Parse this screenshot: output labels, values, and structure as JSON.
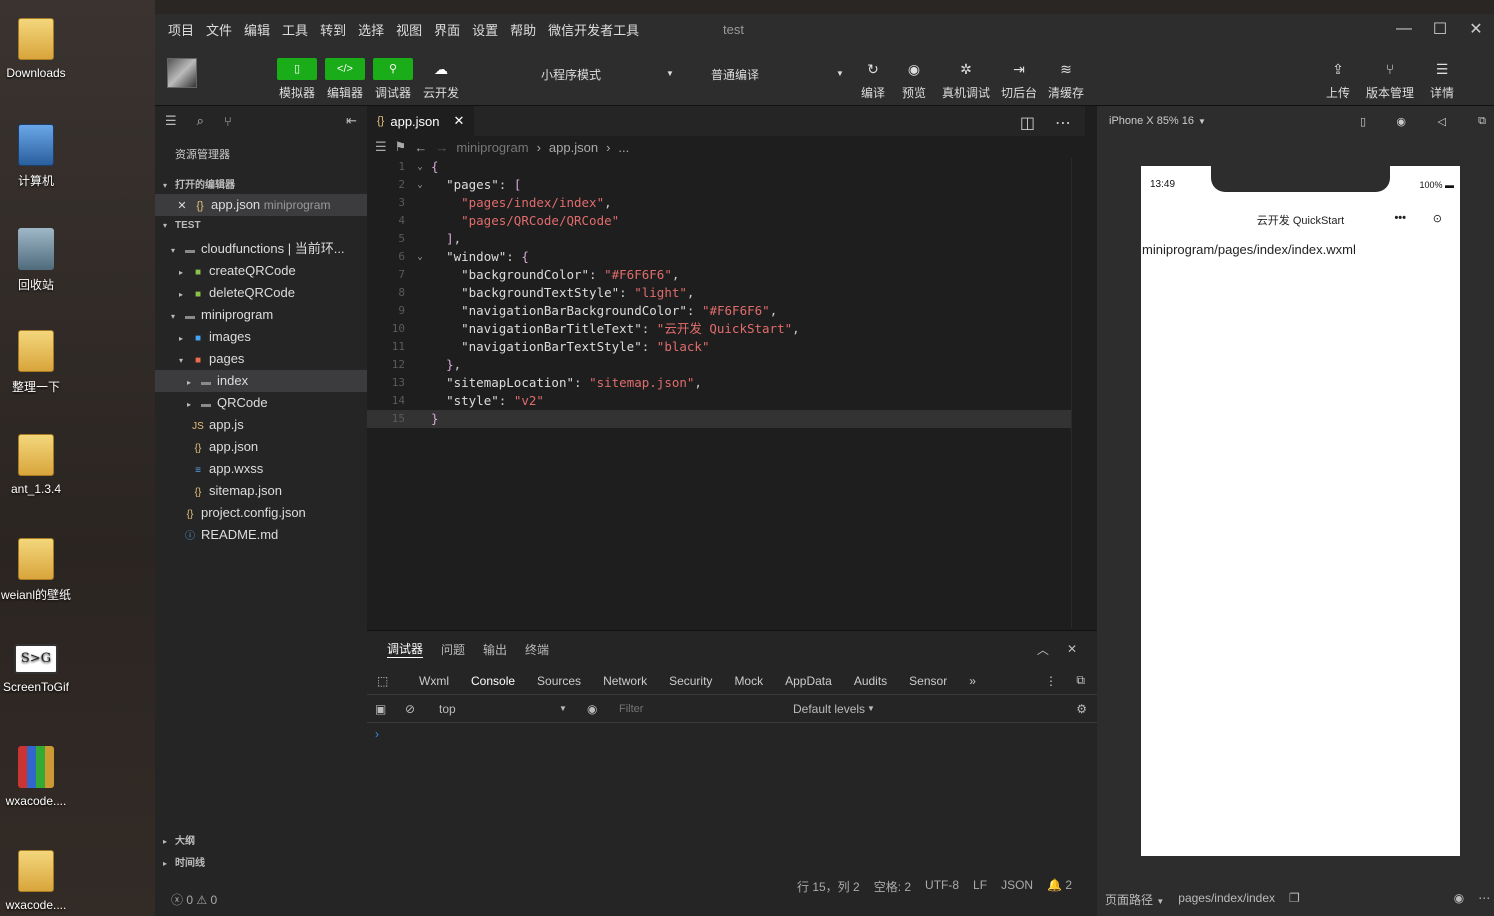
{
  "desktop": {
    "icons": [
      {
        "label": "Downloads",
        "kind": "folder-icon"
      },
      {
        "label": "计算机",
        "kind": "computer-icon"
      },
      {
        "label": "回收站",
        "kind": "recycle-bin-icon"
      },
      {
        "label": "整理一下",
        "kind": "folder-icon"
      },
      {
        "label": "ant_1.3.4",
        "kind": "folder-icon"
      },
      {
        "label": "weianl的壁纸",
        "kind": "folder-icon"
      },
      {
        "label": "ScreenToGif",
        "kind": "screentogif-icon"
      },
      {
        "label": "wxacode....",
        "kind": "winrar-icon"
      },
      {
        "label": "wxacode....",
        "kind": "folder-icon"
      }
    ]
  },
  "titlebar": {
    "menu": [
      "项目",
      "文件",
      "编辑",
      "工具",
      "转到",
      "选择",
      "视图",
      "界面",
      "设置",
      "帮助",
      "微信开发者工具"
    ],
    "title": "test"
  },
  "toolbar": {
    "simulator": "模拟器",
    "editor": "编辑器",
    "debugger": "调试器",
    "cloud": "云开发",
    "mode": "小程序模式",
    "compile_mode": "普通编译",
    "compile": "编译",
    "preview": "预览",
    "real_debug": "真机调试",
    "background": "切后台",
    "clear_cache": "清缓存",
    "upload": "上传",
    "version": "版本管理",
    "details": "详情"
  },
  "sidebar": {
    "title": "资源管理器",
    "open_editors": "打开的编辑器",
    "open_file": "app.json",
    "open_file_dir": "miniprogram",
    "project": "TEST",
    "tree": [
      {
        "label": "cloudfunctions | 当前环...",
        "depth": 1,
        "arrow": "▾",
        "icon": "folder"
      },
      {
        "label": "createQRCode",
        "depth": 2,
        "arrow": "▸",
        "icon": "cloud-folder"
      },
      {
        "label": "deleteQRCode",
        "depth": 2,
        "arrow": "▸",
        "icon": "cloud-folder"
      },
      {
        "label": "miniprogram",
        "depth": 1,
        "arrow": "▾",
        "icon": "folder"
      },
      {
        "label": "images",
        "depth": 2,
        "arrow": "▸",
        "icon": "images-folder"
      },
      {
        "label": "pages",
        "depth": 2,
        "arrow": "▾",
        "icon": "pages-folder"
      },
      {
        "label": "index",
        "depth": 3,
        "arrow": "▸",
        "icon": "folder",
        "selected": true
      },
      {
        "label": "QRCode",
        "depth": 3,
        "arrow": "▸",
        "icon": "folder"
      },
      {
        "label": "app.js",
        "depth": 2,
        "arrow": "",
        "icon": "js"
      },
      {
        "label": "app.json",
        "depth": 2,
        "arrow": "",
        "icon": "json"
      },
      {
        "label": "app.wxss",
        "depth": 2,
        "arrow": "",
        "icon": "wxss"
      },
      {
        "label": "sitemap.json",
        "depth": 2,
        "arrow": "",
        "icon": "json"
      },
      {
        "label": "project.config.json",
        "depth": 1,
        "arrow": "",
        "icon": "json"
      },
      {
        "label": "README.md",
        "depth": 1,
        "arrow": "",
        "icon": "info"
      }
    ],
    "outline": "大纲",
    "timeline": "时间线",
    "errors": "0",
    "warnings": "0"
  },
  "editor": {
    "tab": "app.json",
    "breadcrumb": [
      "miniprogram",
      "app.json",
      "..."
    ],
    "lines": [
      "{",
      "  \"pages\": [",
      "    \"pages/index/index\",",
      "    \"pages/QRCode/QRCode\"",
      "  ],",
      "  \"window\": {",
      "    \"backgroundColor\": \"#F6F6F6\",",
      "    \"backgroundTextStyle\": \"light\",",
      "    \"navigationBarBackgroundColor\": \"#F6F6F6\",",
      "    \"navigationBarTitleText\": \"云开发 QuickStart\",",
      "    \"navigationBarTextStyle\": \"black\"",
      "  },",
      "  \"sitemapLocation\": \"sitemap.json\",",
      "  \"style\": \"v2\"",
      "}"
    ]
  },
  "panel": {
    "tabs": [
      "调试器",
      "问题",
      "输出",
      "终端"
    ],
    "devtabs": [
      "Wxml",
      "Console",
      "Sources",
      "Network",
      "Security",
      "Mock",
      "AppData",
      "Audits",
      "Sensor"
    ],
    "context": "top",
    "filter_placeholder": "Filter",
    "levels": "Default levels"
  },
  "statusbar": {
    "position": "行 15，列 2",
    "spaces": "空格: 2",
    "encoding": "UTF-8",
    "eol": "LF",
    "lang": "JSON",
    "notifications": "2"
  },
  "simulator": {
    "device": "iPhone X 85% 16",
    "time": "13:49",
    "battery": "100%",
    "nav_title": "云开发 QuickStart",
    "content": "miniprogram/pages/index/index.wxml",
    "path_label": "页面路径",
    "path": "pages/index/index"
  },
  "colors": {
    "accent": "#1aad19",
    "string": "#e06c6c",
    "punct": "#d4a9d4"
  }
}
